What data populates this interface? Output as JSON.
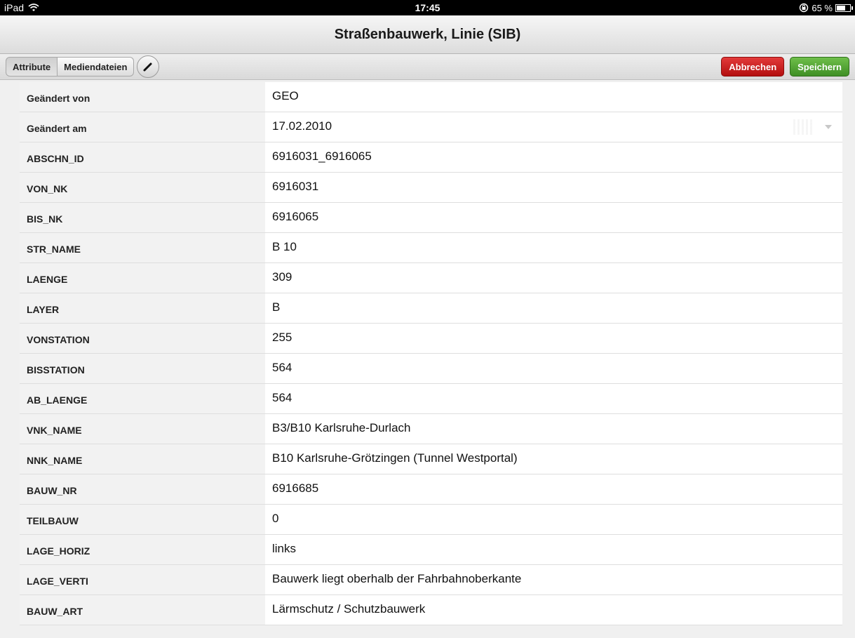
{
  "status_bar": {
    "device": "iPad",
    "time": "17:45",
    "battery_percent": "65 %",
    "battery_level": 0.65
  },
  "title": "Straßenbauwerk, Linie (SIB)",
  "toolbar": {
    "tab_attribute": "Attribute",
    "tab_media": "Mediendateien",
    "cancel_label": "Abbrechen",
    "save_label": "Speichern"
  },
  "rows": [
    {
      "label": "Geändert von",
      "value": "GEO"
    },
    {
      "label": "Geändert am",
      "value": "17.02.2010"
    },
    {
      "label": "ABSCHN_ID",
      "value": "6916031_6916065"
    },
    {
      "label": "VON_NK",
      "value": "6916031"
    },
    {
      "label": "BIS_NK",
      "value": "6916065"
    },
    {
      "label": "STR_NAME",
      "value": "B 10"
    },
    {
      "label": "LAENGE",
      "value": "309"
    },
    {
      "label": "LAYER",
      "value": "B"
    },
    {
      "label": "VONSTATION",
      "value": "255"
    },
    {
      "label": "BISSTATION",
      "value": "564"
    },
    {
      "label": "AB_LAENGE",
      "value": "564"
    },
    {
      "label": "VNK_NAME",
      "value": "B3/B10 Karlsruhe-Durlach"
    },
    {
      "label": "NNK_NAME",
      "value": "B10 Karlsruhe-Grötzingen (Tunnel Westportal)"
    },
    {
      "label": "BAUW_NR",
      "value": "6916685"
    },
    {
      "label": "TEILBAUW",
      "value": "0"
    },
    {
      "label": "LAGE_HORIZ",
      "value": "links"
    },
    {
      "label": "LAGE_VERTI",
      "value": "Bauwerk liegt oberhalb  der Fahrbahnoberkante"
    },
    {
      "label": "BAUW_ART",
      "value": "Lärmschutz / Schutzbauwerk"
    }
  ]
}
